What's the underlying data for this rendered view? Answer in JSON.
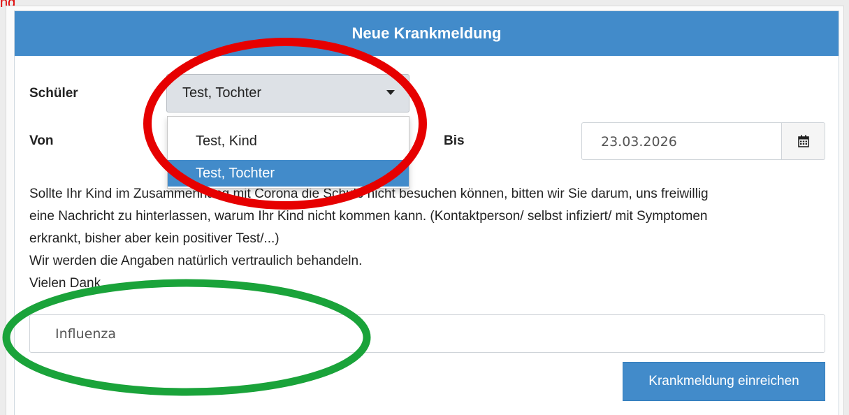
{
  "caption": "ng",
  "panel": {
    "title": "Neue Krankmeldung"
  },
  "student": {
    "label": "Schüler",
    "selected": "Test, Tochter",
    "options": [
      "Test, Kind",
      "Test, Tochter"
    ],
    "highlighted_option": "Test, Tochter"
  },
  "date_from": {
    "label": "Von"
  },
  "date_to": {
    "label": "Bis",
    "value": "23.03.2026"
  },
  "info_text": {
    "lines": [
      "Sollte Ihr Kind im Zusammenhang mit Corona die Schule nicht besuchen können, bitten wir Sie darum, uns freiwillig",
      "eine Nachricht zu hinterlassen, warum Ihr Kind nicht kommen kann. (Kontaktperson/ selbst infiziert/ mit Symptomen",
      "erkrankt, bisher aber kein positiver Test/...)",
      "Wir werden die Angaben natürlich vertraulich behandeln.",
      "Vielen Dank."
    ]
  },
  "note": {
    "value": "Influenza"
  },
  "submit": {
    "label": "Krankmeldung einreichen"
  },
  "icons": {
    "calendar": "calendar-icon",
    "caret": "caret-down-icon"
  },
  "colors": {
    "header": "#428bca",
    "selected_option": "#428bca",
    "annotation_red": "#e60000",
    "annotation_green": "#1aa33a",
    "caption": "#e00000"
  }
}
